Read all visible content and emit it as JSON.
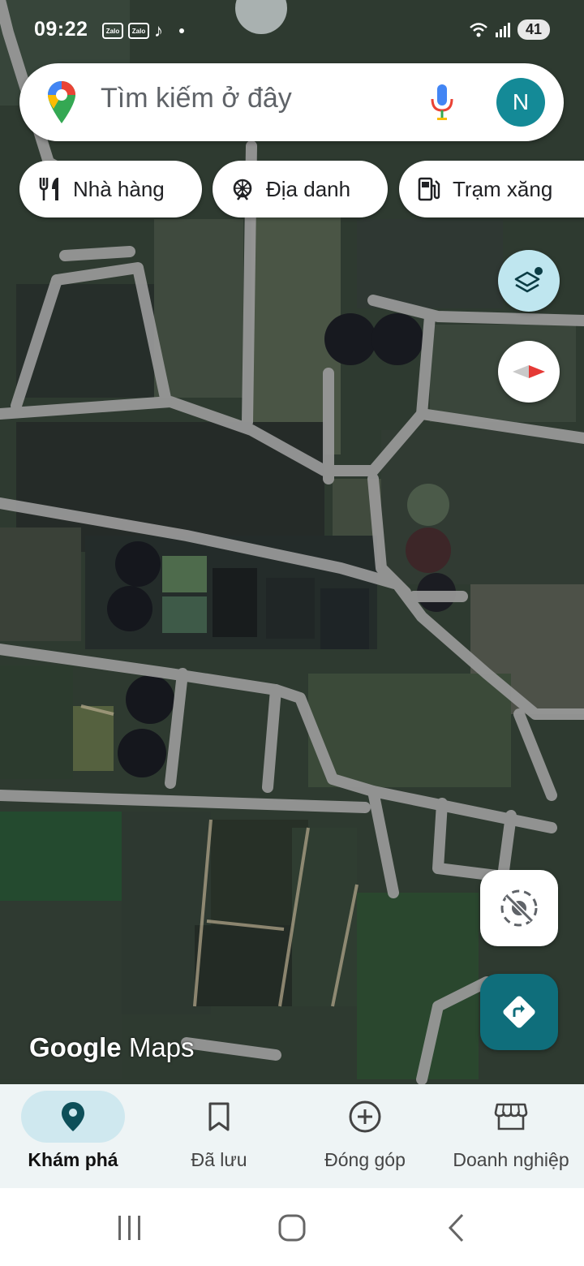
{
  "status_bar": {
    "time": "09:22",
    "app_icons": [
      "Zalo",
      "Zalo",
      "tiktok-icon"
    ],
    "battery": "41"
  },
  "search": {
    "placeholder": "Tìm kiếm ở đây",
    "avatar_initial": "N"
  },
  "chips": [
    {
      "label": "Nhà hàng",
      "icon": "restaurant-icon"
    },
    {
      "label": "Địa danh",
      "icon": "landmark-icon"
    },
    {
      "label": "Trạm xăng",
      "icon": "gas-station-icon"
    }
  ],
  "watermark": {
    "google": "Google",
    "maps": "Maps"
  },
  "bottom_nav": [
    {
      "label": "Khám phá",
      "icon": "location-pin-icon",
      "active": true
    },
    {
      "label": "Đã lưu",
      "icon": "bookmark-icon",
      "active": false
    },
    {
      "label": "Đóng góp",
      "icon": "add-circle-icon",
      "active": false
    },
    {
      "label": "Doanh nghiệp",
      "icon": "storefront-icon",
      "active": false
    }
  ],
  "colors": {
    "accent_teal": "#0f6e7b",
    "avatar_bg": "#148a97",
    "layers_button_bg": "#bfe6ef",
    "nav_active_pill": "#cfe8ef",
    "road_gray": "#9a9a9a"
  }
}
